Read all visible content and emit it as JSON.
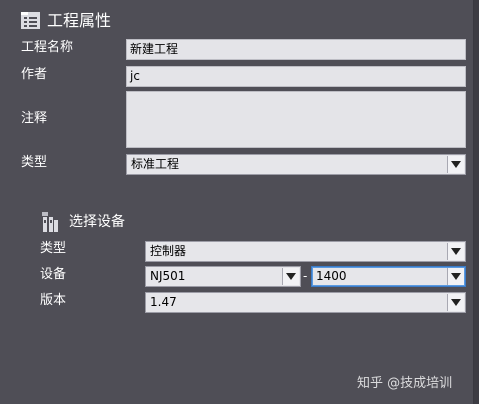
{
  "header": {
    "title": "工程属性",
    "icon": "project-properties-icon"
  },
  "project": {
    "name_label": "工程名称",
    "name_value": "新建工程",
    "author_label": "作者",
    "author_value": "jc",
    "comment_label": "注释",
    "comment_value": "",
    "type_label": "类型",
    "type_value": "标准工程"
  },
  "device_section": {
    "title": "选择设备",
    "icon": "select-device-icon",
    "type_label": "类型",
    "type_value": "控制器",
    "device_label": "设备",
    "device_model": "NJ501",
    "device_separator": "-",
    "device_variant": "1400",
    "version_label": "版本",
    "version_value": "1.47"
  },
  "watermark": {
    "text": "知乎 @技成培训"
  }
}
